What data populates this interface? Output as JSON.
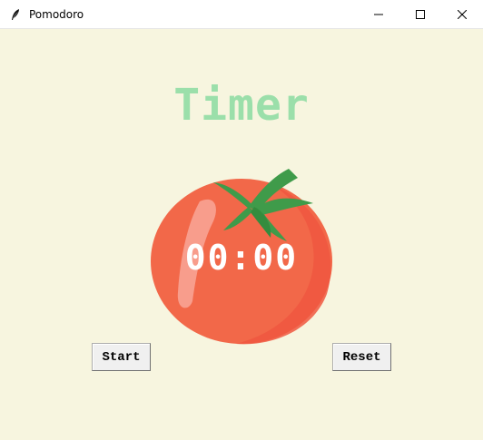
{
  "window": {
    "title": "Pomodoro",
    "icon": "feather-icon",
    "controls": [
      "minimize-icon",
      "maximize-icon",
      "close-icon"
    ]
  },
  "app": {
    "heading": "Timer",
    "timer": "00:00",
    "start_label": "Start",
    "reset_label": "Reset"
  },
  "colors": {
    "background": "#f7f5df",
    "heading": "#9bdfaa",
    "tomato": "#f26849",
    "leaf": "#3f9b4a",
    "timer_text": "#ffffff"
  }
}
